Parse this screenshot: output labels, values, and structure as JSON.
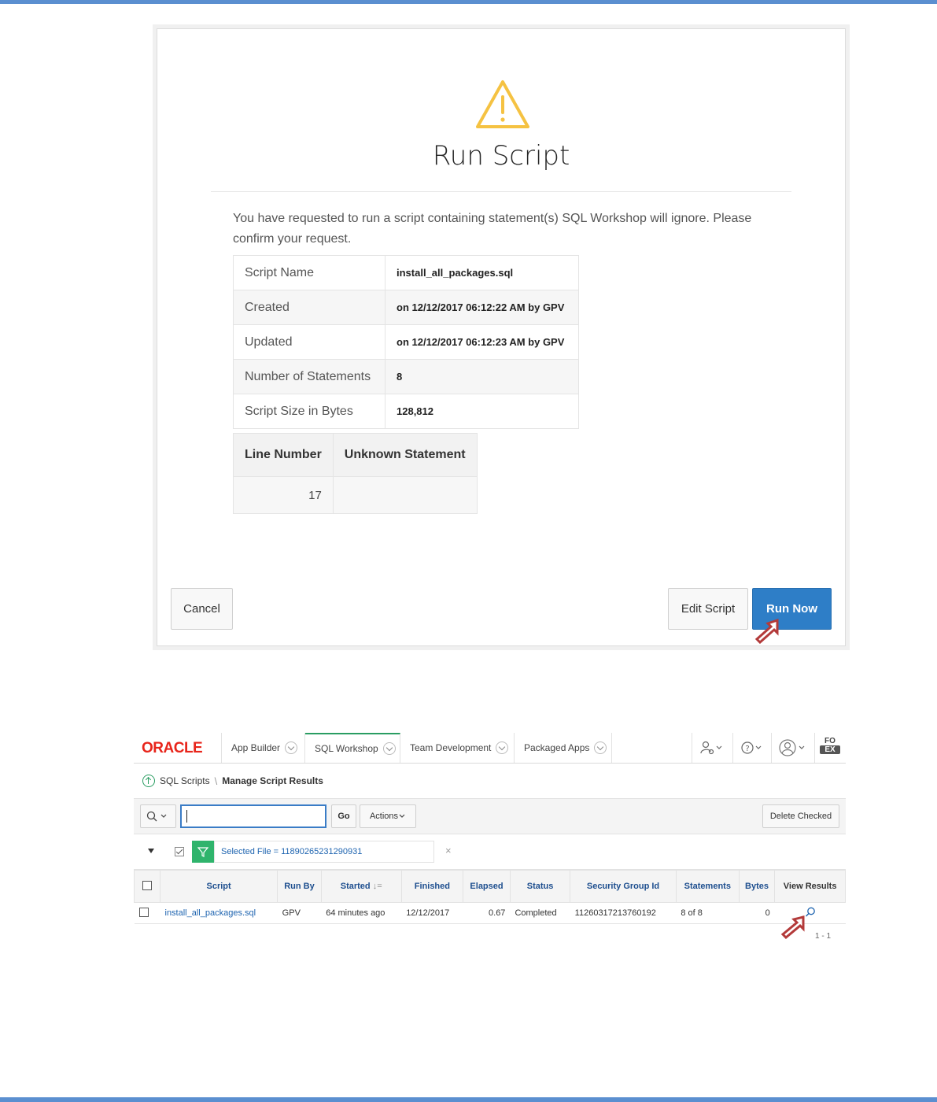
{
  "dialog": {
    "title": "Run Script",
    "message": "You have requested to run a script containing statement(s) SQL Workshop will ignore. Please confirm your request.",
    "details": [
      {
        "label": "Script Name",
        "value": "install_all_packages.sql"
      },
      {
        "label": "Created",
        "value": "on 12/12/2017 06:12:22 AM by GPV"
      },
      {
        "label": "Updated",
        "value": "on 12/12/2017 06:12:23 AM by GPV"
      },
      {
        "label": "Number of Statements",
        "value": "8"
      },
      {
        "label": "Script Size in Bytes",
        "value": "128,812"
      }
    ],
    "unknown_table": {
      "headers": [
        "Line Number",
        "Unknown Statement"
      ],
      "rows": [
        [
          "17",
          ""
        ]
      ]
    },
    "buttons": {
      "cancel": "Cancel",
      "edit": "Edit Script",
      "run": "Run Now"
    },
    "colors": {
      "warning": "#f5c242",
      "primary": "#2e7ec7",
      "pointer_arrow": "#b33a3a"
    }
  },
  "app": {
    "logo": "ORACLE",
    "tabs": [
      "App Builder",
      "SQL Workshop",
      "Team Development",
      "Packaged Apps"
    ],
    "active_tab": "SQL Workshop",
    "badge": {
      "top": "FO",
      "bottom": "EX"
    },
    "breadcrumb": {
      "parent": "SQL Scripts",
      "current": "Manage Script Results"
    },
    "toolbar": {
      "go": "Go",
      "actions": "Actions",
      "delete": "Delete Checked"
    },
    "filter": {
      "text": "Selected File = 11890265231290931",
      "close": "×"
    },
    "grid": {
      "headers": [
        "Script",
        "Run By",
        "Started",
        "Finished",
        "Elapsed",
        "Status",
        "Security Group Id",
        "Statements",
        "Bytes",
        "View Results"
      ],
      "rows": [
        {
          "script": "install_all_packages.sql",
          "run_by": "GPV",
          "started": "64 minutes ago",
          "finished": "12/12/2017",
          "elapsed": "0.67",
          "status": "Completed",
          "security_group_id": "11260317213760192",
          "statements": "8 of 8",
          "bytes": "0"
        }
      ],
      "pagination": "1 - 1",
      "sort_indicator": "↓="
    }
  }
}
